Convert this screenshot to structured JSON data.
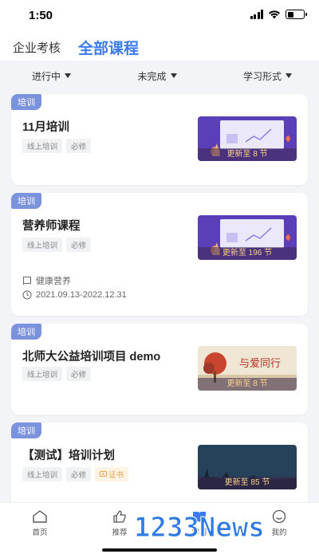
{
  "status": {
    "time": "1:50"
  },
  "header": {
    "tabs": [
      "企业考核",
      "全部课程"
    ]
  },
  "filters": [
    "进行中",
    "未完成",
    "学习形式"
  ],
  "courses": [
    {
      "badge": "培训",
      "title": "11月培训",
      "tags": [
        "线上培训",
        "必修"
      ],
      "thumb_caption": "更新至 8 节"
    },
    {
      "badge": "培训",
      "title": "营养师课程",
      "tags": [
        "线上培训",
        "必修"
      ],
      "thumb_caption": "更新至 196 节",
      "category": "健康营养",
      "date_range": "2021.09.13-2022.12.31"
    },
    {
      "badge": "培训",
      "title": "北师大公益培训项目 demo",
      "tags": [
        "线上培训",
        "必修"
      ],
      "thumb_caption": "更新至 8 节",
      "thumb_art_text": "与爱同行"
    },
    {
      "badge": "培训",
      "title": "【测试】培训计划",
      "tags": [
        "线上培训",
        "必修",
        "证书"
      ],
      "thumb_caption": "更新至 85 节"
    }
  ],
  "nav": [
    "首页",
    "推荐",
    "学习",
    "我的"
  ],
  "watermark": "1233News",
  "colors": {
    "accent": "#3a7bf2",
    "badge": "#7b93dd",
    "cert": "#e9a24b"
  }
}
